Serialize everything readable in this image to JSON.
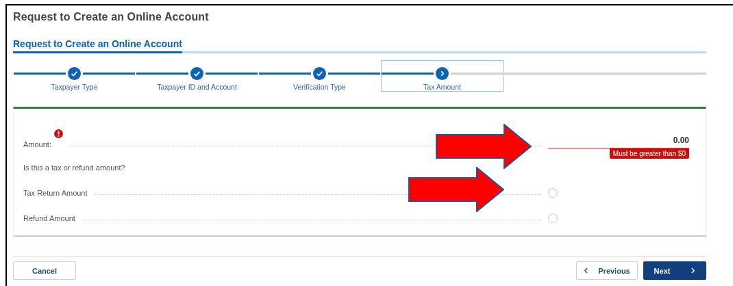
{
  "page_title": "Request to Create an Online Account",
  "section_title": "Request to Create an Online Account",
  "steps": [
    {
      "label": "Taxpayer Type",
      "completed": true,
      "selected": false
    },
    {
      "label": "Taxpayer ID and Account",
      "completed": true,
      "selected": false
    },
    {
      "label": "Verification Type",
      "completed": true,
      "selected": false
    },
    {
      "label": "Tax Amount",
      "completed": false,
      "selected": true
    }
  ],
  "form": {
    "amount": {
      "label": "Amount:",
      "error": true,
      "value": "0.00",
      "message": "Must be greater than $0"
    },
    "question": "Is this a tax or refund amount?",
    "options": [
      {
        "label": "Tax Return Amount",
        "selected": false
      },
      {
        "label": "Refund Amount",
        "selected": false
      }
    ]
  },
  "annotations": [
    {
      "kind": "arrow"
    },
    {
      "kind": "arrow"
    }
  ],
  "buttons": {
    "cancel": "Cancel",
    "previous": "Previous",
    "next": "Next"
  }
}
